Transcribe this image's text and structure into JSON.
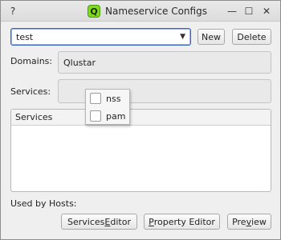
{
  "window": {
    "title": "Nameservice Configs",
    "app_icon_letter": "Q"
  },
  "titlebar_buttons": {
    "help": "?",
    "minimize": "—",
    "maximize": "☐",
    "close": "✕"
  },
  "toolbar": {
    "config_select_value": "test",
    "new_label": "New",
    "delete_label": "Delete"
  },
  "domains": {
    "label": "Domains:",
    "value": "Qlustar"
  },
  "services": {
    "label": "Services:",
    "options": [
      {
        "label": "nss",
        "checked": false
      },
      {
        "label": "pam",
        "checked": false
      }
    ]
  },
  "services_table": {
    "header": "Services"
  },
  "used_by": {
    "label": "Used by Hosts:"
  },
  "bottom_buttons": {
    "services_editor": {
      "pre": "Services ",
      "mnemonic": "E",
      "post": "ditor"
    },
    "property_editor": {
      "pre": "",
      "mnemonic": "P",
      "post": "roperty Editor"
    },
    "preview": {
      "pre": "Pre",
      "mnemonic": "v",
      "post": "iew"
    }
  }
}
